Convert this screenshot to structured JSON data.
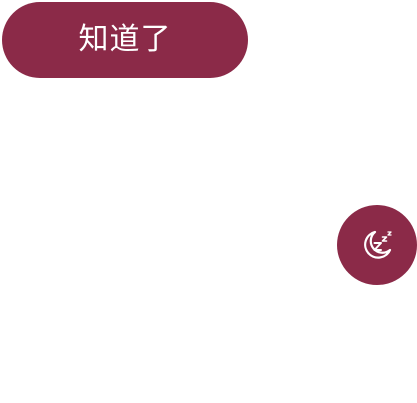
{
  "dialog": {
    "confirm_label": "知道了"
  },
  "sleep_fab": {
    "icon": "moon-sleep-icon",
    "color": "#8b2a48"
  },
  "colors": {
    "accent": "#8b2a48",
    "on_accent": "#ffffff",
    "background": "#ffffff"
  }
}
